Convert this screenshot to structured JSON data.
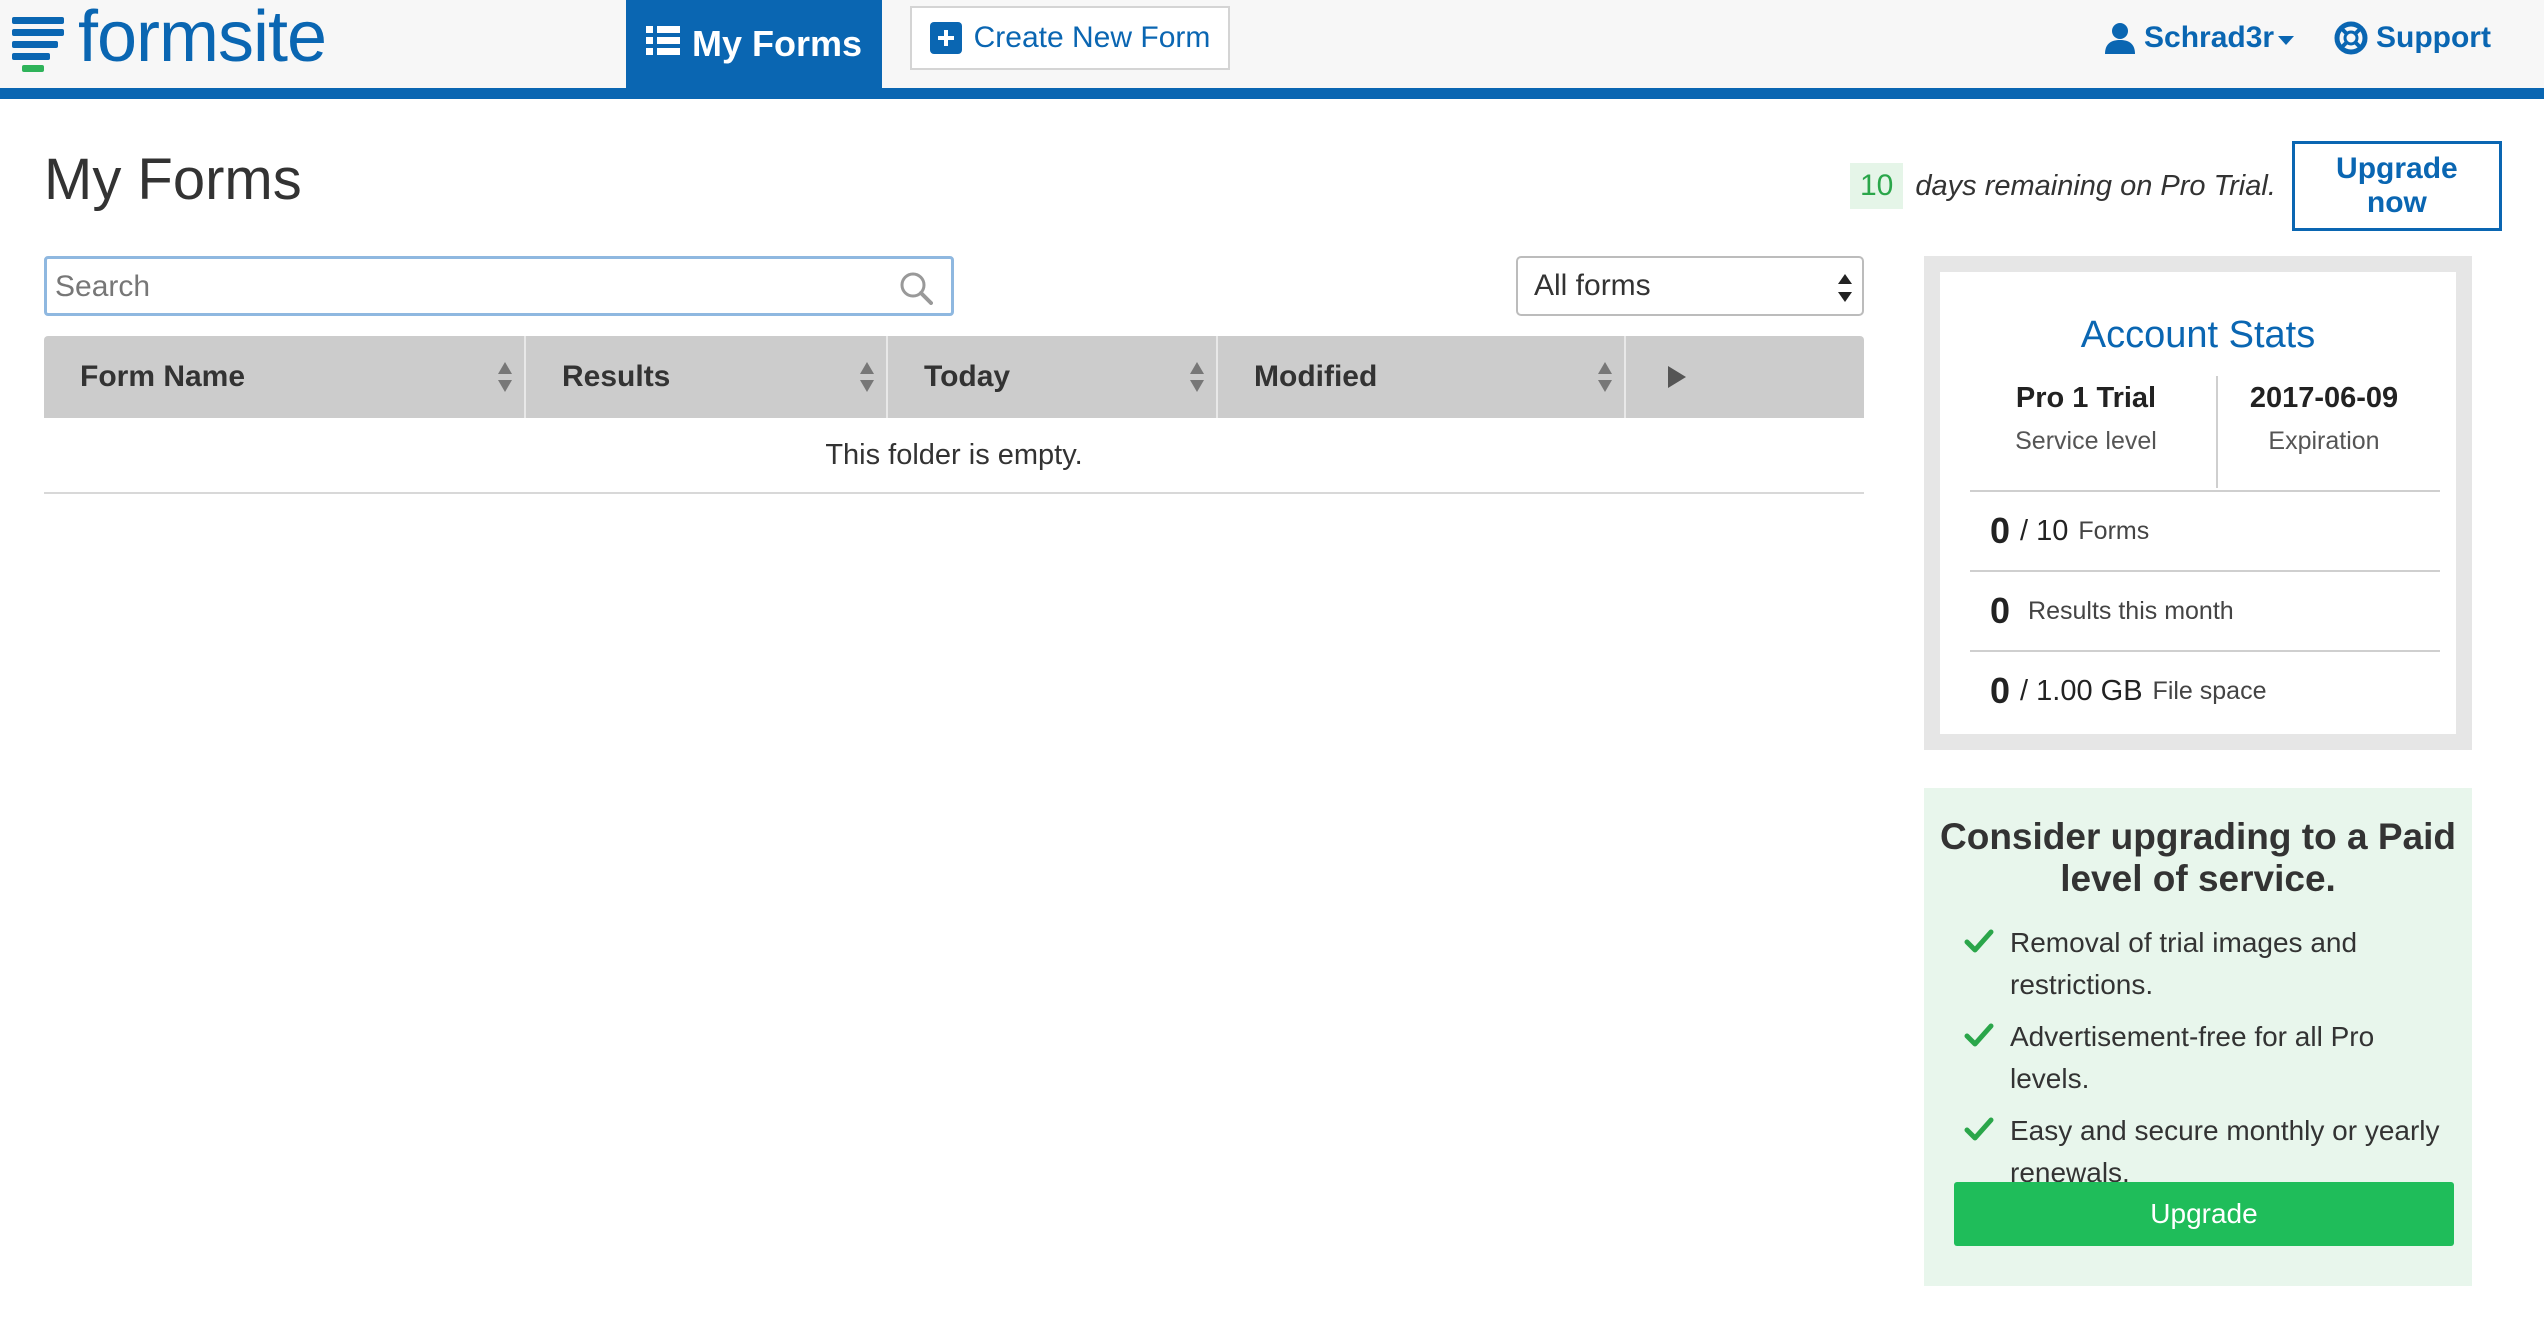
{
  "brand": {
    "name": "formsite",
    "color": "#0a66b2",
    "accent_green": "#2fb35a"
  },
  "nav": {
    "my_forms": {
      "label": "My Forms",
      "icon": "list-icon"
    },
    "create": {
      "label": "Create New Form",
      "icon": "plus-square-icon"
    },
    "user": {
      "label": "Schrad3r",
      "icon": "user-icon"
    },
    "support": {
      "label": "Support",
      "icon": "lifebuoy-icon"
    }
  },
  "page": {
    "title": "My Forms"
  },
  "trial": {
    "days": "10",
    "text": "days remaining on Pro Trial.",
    "upgrade_label": "Upgrade now"
  },
  "search": {
    "placeholder": "Search",
    "value": ""
  },
  "filter": {
    "selected": "All forms"
  },
  "table": {
    "columns": [
      "Form Name",
      "Results",
      "Today",
      "Modified"
    ],
    "empty_message": "This folder is empty."
  },
  "stats": {
    "title": "Account Stats",
    "service_level": {
      "value": "Pro 1 Trial",
      "label": "Service level"
    },
    "expiration": {
      "value": "2017-06-09",
      "label": "Expiration"
    },
    "forms": {
      "used": "0",
      "limit": "/ 10",
      "label": "Forms"
    },
    "results": {
      "used": "0",
      "label": "Results this month"
    },
    "file_space": {
      "used": "0",
      "limit": "/ 1.00 GB",
      "label": "File space"
    }
  },
  "upgrade": {
    "title": "Consider upgrading to a Paid level of service.",
    "benefits": [
      "Removal of trial images and restrictions.",
      "Advertisement-free for all Pro levels.",
      "Easy and secure monthly or yearly renewals."
    ],
    "button_label": "Upgrade"
  }
}
